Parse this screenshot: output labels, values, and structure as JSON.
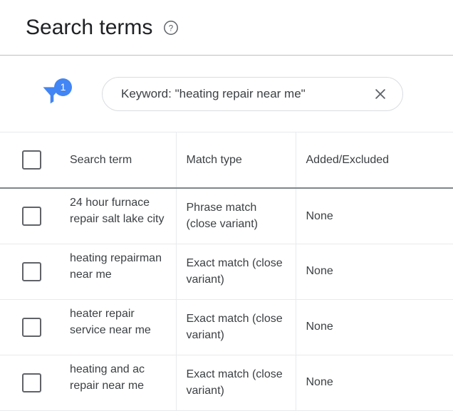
{
  "header": {
    "title": "Search terms",
    "help_icon": "help-circle-icon"
  },
  "filters": {
    "filter_icon": "filter-funnel-icon",
    "badge_count": "1",
    "badge_color": "#4285f4",
    "chip": {
      "label": "Keyword: \"heating repair near me\"",
      "close_icon": "close-x-icon"
    }
  },
  "table": {
    "select_all_checkbox": "unchecked",
    "columns": [
      {
        "key": "checkbox",
        "label": ""
      },
      {
        "key": "search_term",
        "label": "Search term"
      },
      {
        "key": "match_type",
        "label": "Match type"
      },
      {
        "key": "added_excluded",
        "label": "Added/Excluded"
      }
    ],
    "rows": [
      {
        "checkbox": "unchecked",
        "search_term": "24 hour furnace repair salt lake city",
        "match_type": "Phrase match (close variant)",
        "added_excluded": "None"
      },
      {
        "checkbox": "unchecked",
        "search_term": "heating repairman near me",
        "match_type": "Exact match (close variant)",
        "added_excluded": "None"
      },
      {
        "checkbox": "unchecked",
        "search_term": "heater repair service near me",
        "match_type": "Exact match (close variant)",
        "added_excluded": "None"
      },
      {
        "checkbox": "unchecked",
        "search_term": "heating and ac repair near me",
        "match_type": "Exact match (close variant)",
        "added_excluded": "None"
      }
    ]
  }
}
